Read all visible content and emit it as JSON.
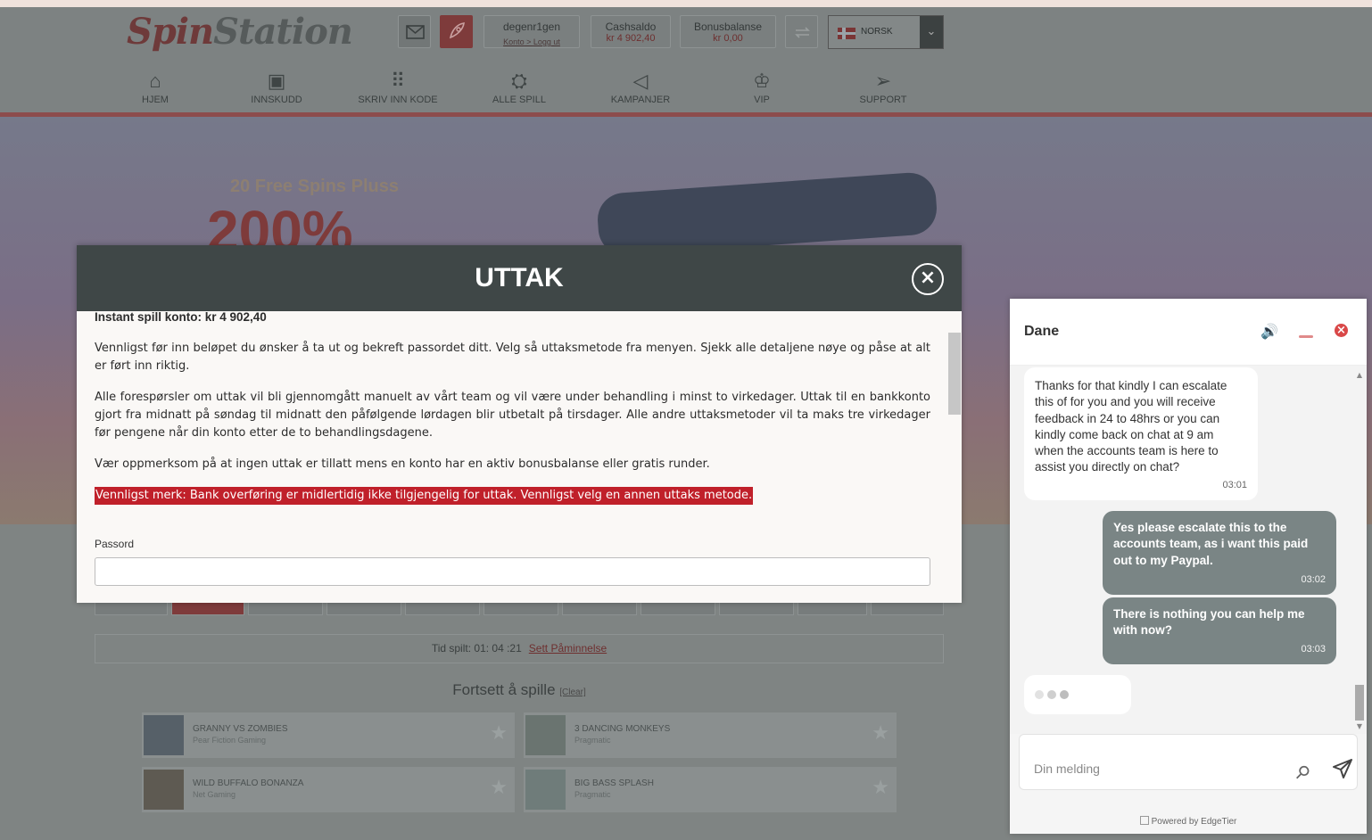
{
  "site": {
    "logo_a": "Spin",
    "logo_b": "Station",
    "username": "degenr1gen",
    "account_link": "Konto",
    "logout_link": "Logg ut",
    "cash_label": "Cashsaldo",
    "cash_value": "kr 4 902,40",
    "bonus_label": "Bonusbalanse",
    "bonus_value": "kr 0,00",
    "language": "NORSK",
    "nav": [
      {
        "label": "HJEM",
        "icon": "home-icon"
      },
      {
        "label": "INNSKUDD",
        "icon": "safe-icon"
      },
      {
        "label": "SKRIV INN KODE",
        "icon": "keypad-icon"
      },
      {
        "label": "ALLE SPILL",
        "icon": "ufo-icon"
      },
      {
        "label": "KAMPANJER",
        "icon": "megaphone-icon"
      },
      {
        "label": "VIP",
        "icon": "crown-icon"
      },
      {
        "label": "SUPPORT",
        "icon": "paper-plane-icon"
      }
    ],
    "hero_line1": "20 Free Spins Pluss",
    "hero_line2": "200%",
    "time_played_label": "Tid spilt: 01: 04 :21",
    "set_reminder": "Sett Påminnelse",
    "continue_title": "Fortsett å spille",
    "clear_link": "[Clear]",
    "games": [
      {
        "title": "GRANNY VS ZOMBIES",
        "studio": "Pear Fiction Gaming"
      },
      {
        "title": "3 DANCING MONKEYS",
        "studio": "Pragmatic"
      },
      {
        "title": "WILD BUFFALO BONANZA",
        "studio": "Net Gaming"
      },
      {
        "title": "BIG BASS SPLASH",
        "studio": "Pragmatic"
      }
    ]
  },
  "modal": {
    "title": "UTTAK",
    "close": "×",
    "balance_line": "Instant spill konto: kr 4 902,40",
    "para1": "Vennligst før inn beløpet du ønsker å ta ut og bekreft passordet ditt. Velg så uttaksmetode fra menyen. Sjekk alle detaljene nøye og påse at alt er ført inn riktig.",
    "para2": "Alle forespørsler om uttak vil bli gjennomgått manuelt av vårt team og vil være under behandling i minst to virkedager. Uttak til en bankkonto gjort fra midnatt på søndag til midnatt den påfølgende lørdagen blir utbetalt på tirsdager. Alle andre uttaksmetoder vil ta maks tre virkedager før pengene når din konto etter de to behandlingsdagene.",
    "para3": "Vær oppmerksom på at ingen uttak er tillatt mens en konto har en aktiv bonusbalanse eller gratis runder.",
    "warning": "Vennligst merk: Bank overføring er midlertidig ikke tilgjengelig for uttak. Vennligst velg en annen uttaks metode.",
    "password_label": "Passord",
    "password_value": ""
  },
  "chat": {
    "agent_name": "Dane",
    "messages": [
      {
        "from": "agent",
        "text": "Thanks for that kindly I can escalate this of for you and you will receive feedback in 24 to 48hrs or you can kindly come back on chat at 9 am when the accounts team is here to assist you directly on chat?",
        "time": "03:01"
      },
      {
        "from": "user",
        "text": "Yes please escalate this to the accounts team, as i want this paid out to my Paypal.",
        "time": "03:02"
      },
      {
        "from": "user",
        "text": "There is nothing you can help me with now?",
        "time": "03:03"
      }
    ],
    "input_placeholder": "Din melding",
    "powered_by": "Powered by EdgeTier"
  },
  "colors": {
    "modal_header": "#3f4747",
    "warning_bg": "#c0202a",
    "user_bubble": "#7a8585",
    "accent_red": "#c64a4a"
  }
}
